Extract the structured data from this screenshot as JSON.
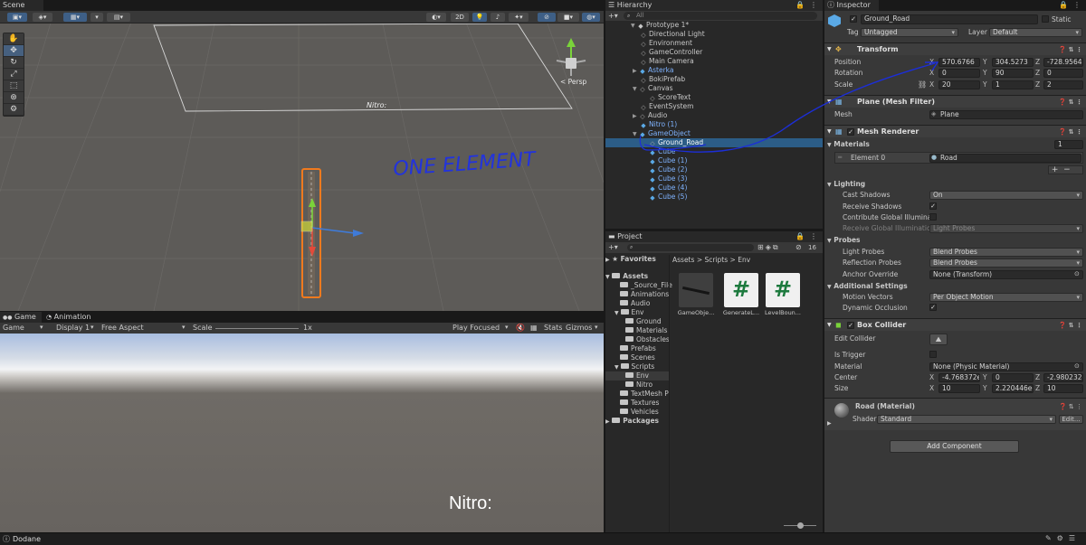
{
  "tabs": {
    "scene": "Scene",
    "game": "Game",
    "animation": "Animation",
    "hierarchy": "Hierarchy",
    "project": "Project",
    "inspector": "Inspector"
  },
  "scene": {
    "btn_2d": "2D",
    "persp_label": "< Persp",
    "nitro_text": "Nitro:",
    "annotation": "ONE ELEMENT"
  },
  "game": {
    "display_select": "Game",
    "display": "Display 1",
    "aspect": "Free Aspect",
    "scale_label": "Scale",
    "scale_value": "1x",
    "play_mode": "Play Focused",
    "stats": "Stats",
    "gizmos": "Gizmos",
    "nitro_text": "Nitro:"
  },
  "hierarchy": {
    "search_placeholder": "All",
    "scene_name": "Prototype 1*",
    "items": [
      {
        "label": "Directional Light",
        "prefab": false
      },
      {
        "label": "Environment",
        "prefab": false
      },
      {
        "label": "GameController",
        "prefab": false
      },
      {
        "label": "Main Camera",
        "prefab": false
      },
      {
        "label": "Asterka",
        "prefab": true
      },
      {
        "label": "BokiPrefab",
        "prefab": false
      },
      {
        "label": "Canvas",
        "prefab": false
      },
      {
        "label": "ScoreText",
        "prefab": false
      },
      {
        "label": "EventSystem",
        "prefab": false
      },
      {
        "label": "Audio",
        "prefab": false
      },
      {
        "label": "Nitro (1)",
        "prefab": true
      },
      {
        "label": "GameObject",
        "prefab": true
      },
      {
        "label": "Ground_Road",
        "prefab": false,
        "selected": true
      },
      {
        "label": "Cube",
        "prefab": true
      },
      {
        "label": "Cube (1)",
        "prefab": true
      },
      {
        "label": "Cube (2)",
        "prefab": true
      },
      {
        "label": "Cube (3)",
        "prefab": true
      },
      {
        "label": "Cube (4)",
        "prefab": true
      },
      {
        "label": "Cube (5)",
        "prefab": true
      }
    ]
  },
  "project": {
    "search_placeholder": "",
    "count": "16",
    "favorites": "Favorites",
    "assets": "Assets",
    "packages": "Packages",
    "tree": [
      "_Source_File",
      "Animations",
      "Audio",
      "Env",
      "Ground",
      "Materials",
      "Obstacles",
      "Prefabs",
      "Scenes",
      "Scripts",
      "Env",
      "Nitro",
      "TextMesh P",
      "Textures",
      "Vehicles"
    ],
    "breadcrumb": [
      "Assets",
      "Scripts",
      "Env"
    ],
    "files": [
      "GameObje...",
      "GenerateL...",
      "LevelBoun..."
    ]
  },
  "inspector": {
    "object_name": "Ground_Road",
    "static_label": "Static",
    "tag_label": "Tag",
    "tag_value": "Untagged",
    "layer_label": "Layer",
    "layer_value": "Default",
    "transform": {
      "title": "Transform",
      "position_label": "Position",
      "rotation_label": "Rotation",
      "scale_label": "Scale",
      "position": {
        "x": "570.6766",
        "y": "304.5273",
        "z": "-728.9564"
      },
      "rotation": {
        "x": "0",
        "y": "90",
        "z": "0"
      },
      "scale": {
        "x": "20",
        "y": "1",
        "z": "2"
      }
    },
    "mesh_filter": {
      "title": "Plane (Mesh Filter)",
      "mesh_label": "Mesh",
      "mesh_value": "Plane"
    },
    "mesh_renderer": {
      "title": "Mesh Renderer",
      "materials_label": "Materials",
      "materials_count": "1",
      "element0_label": "Element 0",
      "element0_value": "Road",
      "lighting_label": "Lighting",
      "cast_shadows_label": "Cast Shadows",
      "cast_shadows_value": "On",
      "receive_shadows_label": "Receive Shadows",
      "contribute_gi_label": "Contribute Global Illuminati",
      "receive_gi_label": "Receive Global Illuminatio",
      "receive_gi_value": "Light Probes",
      "probes_label": "Probes",
      "light_probes_label": "Light Probes",
      "light_probes_value": "Blend Probes",
      "reflection_probes_label": "Reflection Probes",
      "reflection_probes_value": "Blend Probes",
      "anchor_override_label": "Anchor Override",
      "anchor_override_value": "None (Transform)",
      "additional_label": "Additional Settings",
      "motion_vectors_label": "Motion Vectors",
      "motion_vectors_value": "Per Object Motion",
      "dynamic_occlusion_label": "Dynamic Occlusion"
    },
    "box_collider": {
      "title": "Box Collider",
      "edit_collider_label": "Edit Collider",
      "is_trigger_label": "Is Trigger",
      "material_label": "Material",
      "material_value": "None (Physic Material)",
      "center_label": "Center",
      "size_label": "Size",
      "center": {
        "x": "-4.768372e",
        "y": "0",
        "z": "-2.980232e"
      },
      "size": {
        "x": "10",
        "y": "2.220446e-",
        "z": "10"
      }
    },
    "material": {
      "name": "Road (Material)",
      "shader_label": "Shader",
      "shader_value": "Standard",
      "edit_label": "Edit..."
    },
    "add_component": "Add Component"
  },
  "status": {
    "text": "Dodane"
  }
}
